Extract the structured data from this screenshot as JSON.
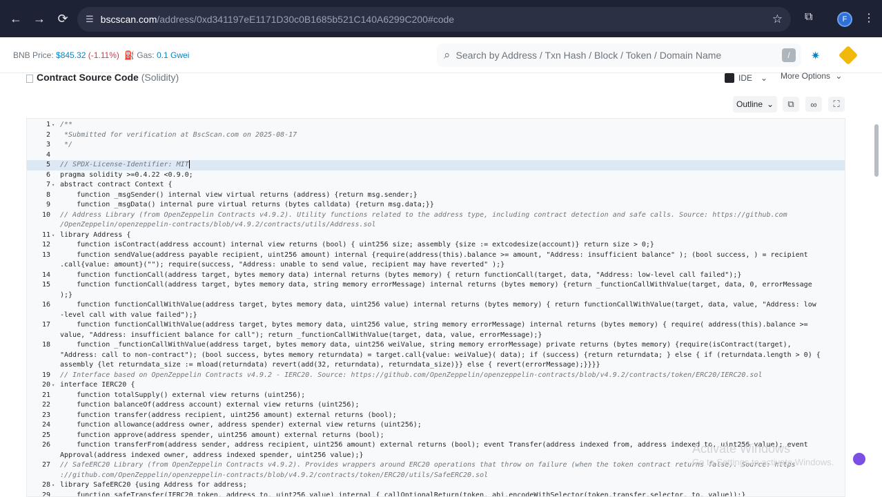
{
  "browser": {
    "url_host": "bscscan.com",
    "url_path": "/address/0xd341197eE1171D30c0B1685b521C140A6299C200#code",
    "profile_initial": "F"
  },
  "header": {
    "bnb_label": "BNB Price:",
    "bnb_price": "$845.32",
    "bnb_change": "(-1.11%)",
    "gas_label": "Gas:",
    "gas_value": "0.1 Gwei",
    "search_placeholder": "Search by Address / Txn Hash / Block / Token / Domain Name",
    "search_shortcut": "/"
  },
  "contract": {
    "title": "Contract Source Code",
    "language": "(Solidity)",
    "ide_label": "IDE",
    "more_label": "More Options",
    "outline_label": "Outline"
  },
  "code_lines": [
    {
      "n": "1",
      "fold": "▾",
      "t": "/**",
      "c": true
    },
    {
      "n": "2",
      "fold": "",
      "t": " *Submitted for verification at BscScan.com on 2025-08-17",
      "c": true
    },
    {
      "n": "3",
      "fold": "",
      "t": " */",
      "c": true
    },
    {
      "n": "4",
      "fold": "",
      "t": "",
      "c": false
    },
    {
      "n": "5",
      "fold": "",
      "t": "// SPDX-License-Identifier: MIT",
      "c": true,
      "active": true
    },
    {
      "n": "6",
      "fold": "",
      "t": "pragma solidity >=0.4.22 <0.9.0;",
      "c": false
    },
    {
      "n": "7",
      "fold": "▾",
      "t": "abstract contract Context {",
      "c": false
    },
    {
      "n": "8",
      "fold": "",
      "t": "    function _msgSender() internal view virtual returns (address) {return msg.sender;}",
      "c": false
    },
    {
      "n": "9",
      "fold": "",
      "t": "    function _msgData() internal pure virtual returns (bytes calldata) {return msg.data;}}",
      "c": false
    },
    {
      "n": "10",
      "fold": "",
      "t": "// Address Library (from OpenZeppelin Contracts v4.9.2). Utility functions related to the address type, including contract detection and safe calls. Source: https://github.com",
      "c": true
    },
    {
      "n": "",
      "fold": "",
      "t": "/OpenZeppelin/openzeppelin-contracts/blob/v4.9.2/contracts/utils/Address.sol",
      "c": true
    },
    {
      "n": "11",
      "fold": "▾",
      "t": "library Address {",
      "c": false
    },
    {
      "n": "12",
      "fold": "",
      "t": "    function isContract(address account) internal view returns (bool) { uint256 size; assembly {size := extcodesize(account)} return size > 0;}",
      "c": false
    },
    {
      "n": "13",
      "fold": "",
      "t": "    function sendValue(address payable recipient, uint256 amount) internal {require(address(this).balance >= amount, \"Address: insufficient balance\" ); (bool success, ) = recipient",
      "c": false
    },
    {
      "n": "",
      "fold": "",
      "t": ".call{value: amount}(\"\"); require(success, \"Address: unable to send value, recipient may have reverted\" );}",
      "c": false
    },
    {
      "n": "14",
      "fold": "",
      "t": "    function functionCall(address target, bytes memory data) internal returns (bytes memory) { return functionCall(target, data, \"Address: low-level call failed\");}",
      "c": false
    },
    {
      "n": "15",
      "fold": "",
      "t": "    function functionCall(address target, bytes memory data, string memory errorMessage) internal returns (bytes memory) {return _functionCallWithValue(target, data, 0, errorMessage",
      "c": false
    },
    {
      "n": "",
      "fold": "",
      "t": ");}",
      "c": false
    },
    {
      "n": "16",
      "fold": "",
      "t": "    function functionCallWithValue(address target, bytes memory data, uint256 value) internal returns (bytes memory) { return functionCallWithValue(target, data, value, \"Address: low",
      "c": false
    },
    {
      "n": "",
      "fold": "",
      "t": "-level call with value failed\");}",
      "c": false
    },
    {
      "n": "17",
      "fold": "",
      "t": "    function functionCallWithValue(address target, bytes memory data, uint256 value, string memory errorMessage) internal returns (bytes memory) { require( address(this).balance >=",
      "c": false
    },
    {
      "n": "",
      "fold": "",
      "t": "value, \"Address: insufficient balance for call\"); return _functionCallWithValue(target, data, value, errorMessage);}",
      "c": false
    },
    {
      "n": "18",
      "fold": "",
      "t": "    function _functionCallWithValue(address target, bytes memory data, uint256 weiValue, string memory errorMessage) private returns (bytes memory) {require(isContract(target),",
      "c": false
    },
    {
      "n": "",
      "fold": "",
      "t": "\"Address: call to non-contract\"); (bool success, bytes memory returndata) = target.call{value: weiValue}( data); if (success) {return returndata; } else { if (returndata.length > 0) {",
      "c": false
    },
    {
      "n": "",
      "fold": "",
      "t": "assembly {let returndata_size := mload(returndata) revert(add(32, returndata), returndata_size)}} else { revert(errorMessage);}}}}",
      "c": false
    },
    {
      "n": "19",
      "fold": "",
      "t": "// Interface based on OpenZeppelin Contracts v4.9.2 - IERC20. Source: https://github.com/OpenZeppelin/openzeppelin-contracts/blob/v4.9.2/contracts/token/ERC20/IERC20.sol",
      "c": true
    },
    {
      "n": "20",
      "fold": "▾",
      "t": "interface IERC20 {",
      "c": false
    },
    {
      "n": "21",
      "fold": "",
      "t": "    function totalSupply() external view returns (uint256);",
      "c": false
    },
    {
      "n": "22",
      "fold": "",
      "t": "    function balanceOf(address account) external view returns (uint256);",
      "c": false
    },
    {
      "n": "23",
      "fold": "",
      "t": "    function transfer(address recipient, uint256 amount) external returns (bool);",
      "c": false
    },
    {
      "n": "24",
      "fold": "",
      "t": "    function allowance(address owner, address spender) external view returns (uint256);",
      "c": false
    },
    {
      "n": "25",
      "fold": "",
      "t": "    function approve(address spender, uint256 amount) external returns (bool);",
      "c": false
    },
    {
      "n": "26",
      "fold": "",
      "t": "    function transferFrom(address sender, address recipient, uint256 amount) external returns (bool); event Transfer(address indexed from, address indexed to, uint256 value); event",
      "c": false
    },
    {
      "n": "",
      "fold": "",
      "t": "Approval(address indexed owner, address indexed spender, uint256 value);}",
      "c": false
    },
    {
      "n": "27",
      "fold": "",
      "t": "// SafeERC20 Library (from OpenZeppelin Contracts v4.9.2). Provides wrappers around ERC20 operations that throw on failure (when the token contract returns false). Source: https",
      "c": true
    },
    {
      "n": "",
      "fold": "",
      "t": "://github.com/OpenZeppelin/openzeppelin-contracts/blob/v4.9.2/contracts/token/ERC20/utils/SafeERC20.sol",
      "c": true
    },
    {
      "n": "28",
      "fold": "▾",
      "t": "library SafeERC20 {using Address for address;",
      "c": false
    },
    {
      "n": "29",
      "fold": "",
      "t": "    function safeTransfer(IERC20 token, address to, uint256 value) internal { callOptionalReturn(token, abi.encodeWithSelector(token.transfer.selector, to, value));}",
      "c": false
    }
  ],
  "watermark": {
    "title": "Activate Windows",
    "sub": "Go to Settings to activate Windows."
  }
}
